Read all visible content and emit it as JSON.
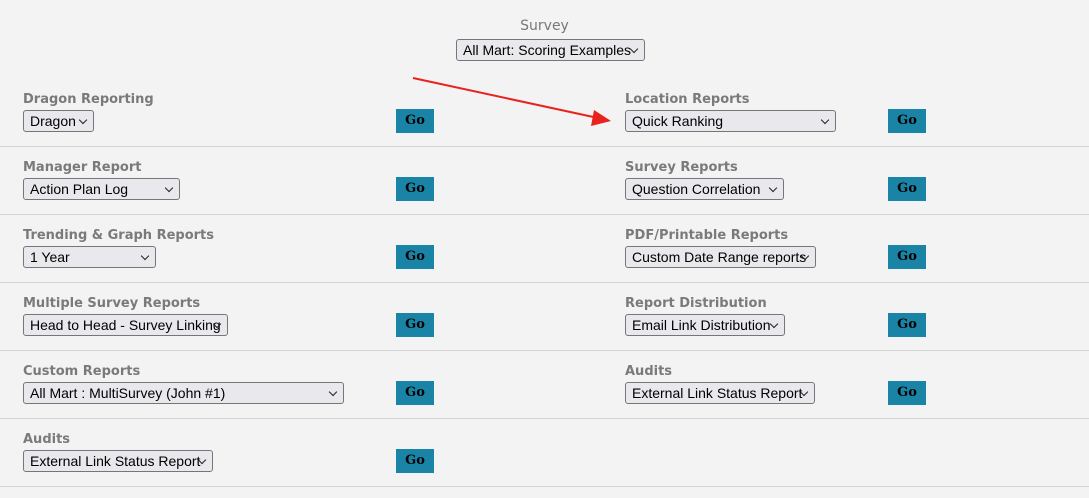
{
  "survey": {
    "label": "Survey",
    "selected": "All Mart: Scoring Examples"
  },
  "go_label": "Go",
  "rows": [
    {
      "left": {
        "title": "Dragon Reporting",
        "selected": "Dragon"
      },
      "right": {
        "title": "Location Reports",
        "selected": "Quick Ranking"
      }
    },
    {
      "left": {
        "title": "Manager Report",
        "selected": "Action Plan Log"
      },
      "right": {
        "title": "Survey Reports",
        "selected": "Question Correlation"
      }
    },
    {
      "left": {
        "title": "Trending & Graph Reports",
        "selected": "1 Year"
      },
      "right": {
        "title": "PDF/Printable Reports",
        "selected": "Custom Date Range reports"
      }
    },
    {
      "left": {
        "title": "Multiple Survey Reports",
        "selected": "Head to Head - Survey Linking"
      },
      "right": {
        "title": "Report Distribution",
        "selected": "Email Link Distribution"
      }
    },
    {
      "left": {
        "title": "Custom Reports",
        "selected": "All Mart : MultiSurvey (John #1)"
      },
      "right": {
        "title": "Audits",
        "selected": "External Link Status Report"
      }
    },
    {
      "left": {
        "title": "Audits",
        "selected": "External Link Status Report"
      }
    }
  ],
  "colors": {
    "go_button": "#1a84a6",
    "annotation_arrow": "#e8221d",
    "background": "#f3f3f3"
  }
}
